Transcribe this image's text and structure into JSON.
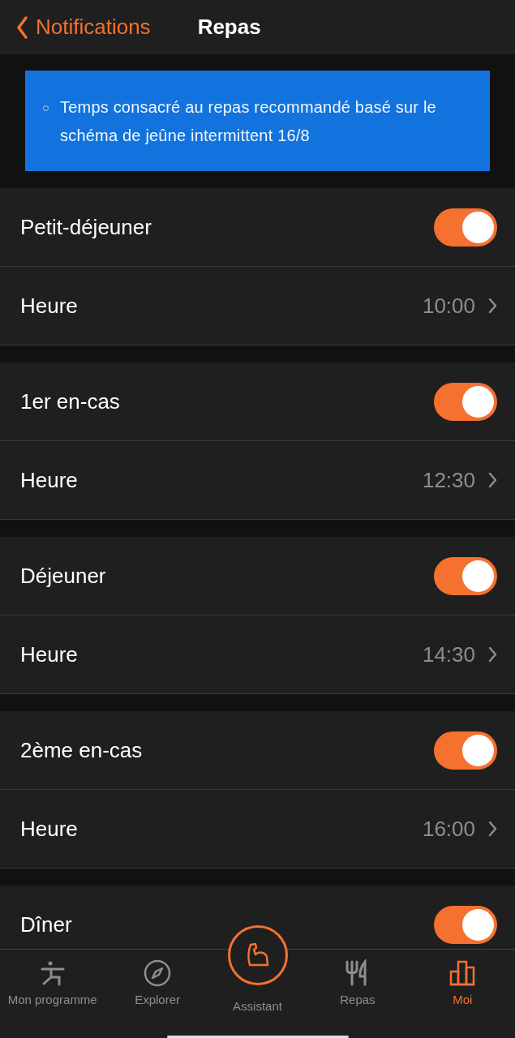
{
  "header": {
    "back_label": "Notifications",
    "title": "Repas"
  },
  "info_banner": {
    "text": "Temps consacré au repas recommandé basé sur le schéma de jeûne intermittent 16/8"
  },
  "meals": [
    {
      "label": "Petit-déjeuner",
      "on": true,
      "time_label": "Heure",
      "time": "10:00"
    },
    {
      "label": "1er en-cas",
      "on": true,
      "time_label": "Heure",
      "time": "12:30"
    },
    {
      "label": "Déjeuner",
      "on": true,
      "time_label": "Heure",
      "time": "14:30"
    },
    {
      "label": "2ème en-cas",
      "on": true,
      "time_label": "Heure",
      "time": "16:00"
    },
    {
      "label": "Dîner",
      "on": true
    }
  ],
  "tab_bar": [
    {
      "label": "Mon programme",
      "selected": false,
      "kind": "plain"
    },
    {
      "label": "Explorer",
      "selected": false,
      "kind": "plain"
    },
    {
      "label": "Assistant",
      "selected": false,
      "kind": "center"
    },
    {
      "label": "Repas",
      "selected": false,
      "kind": "plain"
    },
    {
      "label": "Moi",
      "selected": true,
      "kind": "plain"
    }
  ]
}
